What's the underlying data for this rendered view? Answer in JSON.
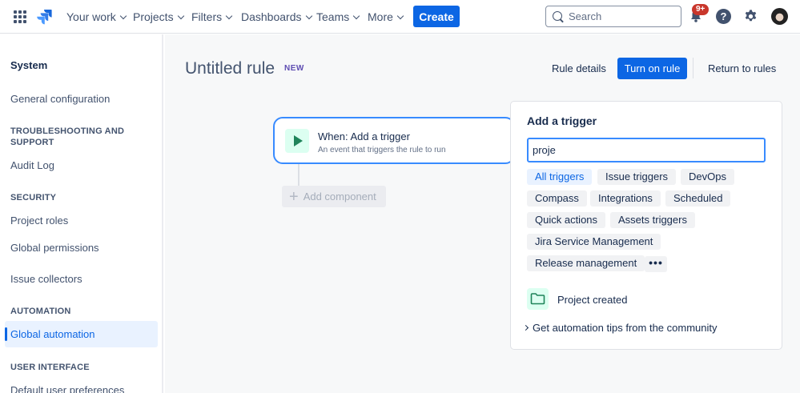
{
  "topnav": {
    "items": [
      "Your work",
      "Projects",
      "Filters",
      "Dashboards",
      "Teams",
      "More"
    ],
    "create_label": "Create",
    "search_placeholder": "Search",
    "notification_count": "9+"
  },
  "sidebar": {
    "title": "System",
    "general_configuration": "General configuration",
    "troubleshooting_heading": "TROUBLESHOOTING AND SUPPORT",
    "audit_log": "Audit Log",
    "security_heading": "SECURITY",
    "project_roles": "Project roles",
    "global_permissions": "Global permissions",
    "issue_collectors": "Issue collectors",
    "automation_heading": "AUTOMATION",
    "global_automation": "Global automation",
    "user_interface_heading": "USER INTERFACE",
    "default_user_preferences": "Default user preferences"
  },
  "header": {
    "rule_title": "Untitled rule",
    "new_tag": "NEW",
    "rule_details": "Rule details",
    "turn_on_rule": "Turn on rule",
    "return_to_rules": "Return to rules"
  },
  "canvas": {
    "trigger_title": "When: Add a trigger",
    "trigger_subtitle": "An event that triggers the rule to run",
    "add_component": "Add component"
  },
  "panel": {
    "title": "Add a trigger",
    "search_value": "proje",
    "categories": [
      "All triggers",
      "Issue triggers",
      "DevOps",
      "Compass",
      "Integrations",
      "Scheduled",
      "Quick actions",
      "Assets triggers",
      "Jira Service Management",
      "Release management"
    ],
    "more_label": "•••",
    "result_label": "Project created",
    "tips_label": "Get automation tips from the community"
  },
  "colors": {
    "primary": "#0c66e4",
    "trigger_border": "#388bff",
    "trigger_green": "#1f845a"
  }
}
